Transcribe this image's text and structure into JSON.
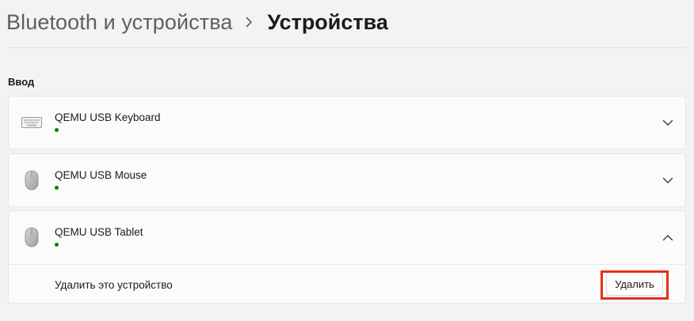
{
  "header": {
    "parent": "Bluetooth и устройства",
    "separator_icon": "chevron-right-icon",
    "current": "Устройства"
  },
  "section": {
    "title": "Ввод"
  },
  "devices": [
    {
      "name": "QEMU USB Keyboard",
      "icon": "keyboard-icon",
      "status_color": "#107c10",
      "expanded": false,
      "chevron": "chevron-down-icon"
    },
    {
      "name": "QEMU USB Mouse",
      "icon": "mouse-icon",
      "status_color": "#107c10",
      "expanded": false,
      "chevron": "chevron-down-icon"
    },
    {
      "name": "QEMU USB Tablet",
      "icon": "mouse-icon",
      "status_color": "#107c10",
      "expanded": true,
      "chevron": "chevron-up-icon",
      "remove_label": "Удалить это устройство",
      "remove_button": "Удалить"
    }
  ],
  "highlight_color": "#e0321c"
}
